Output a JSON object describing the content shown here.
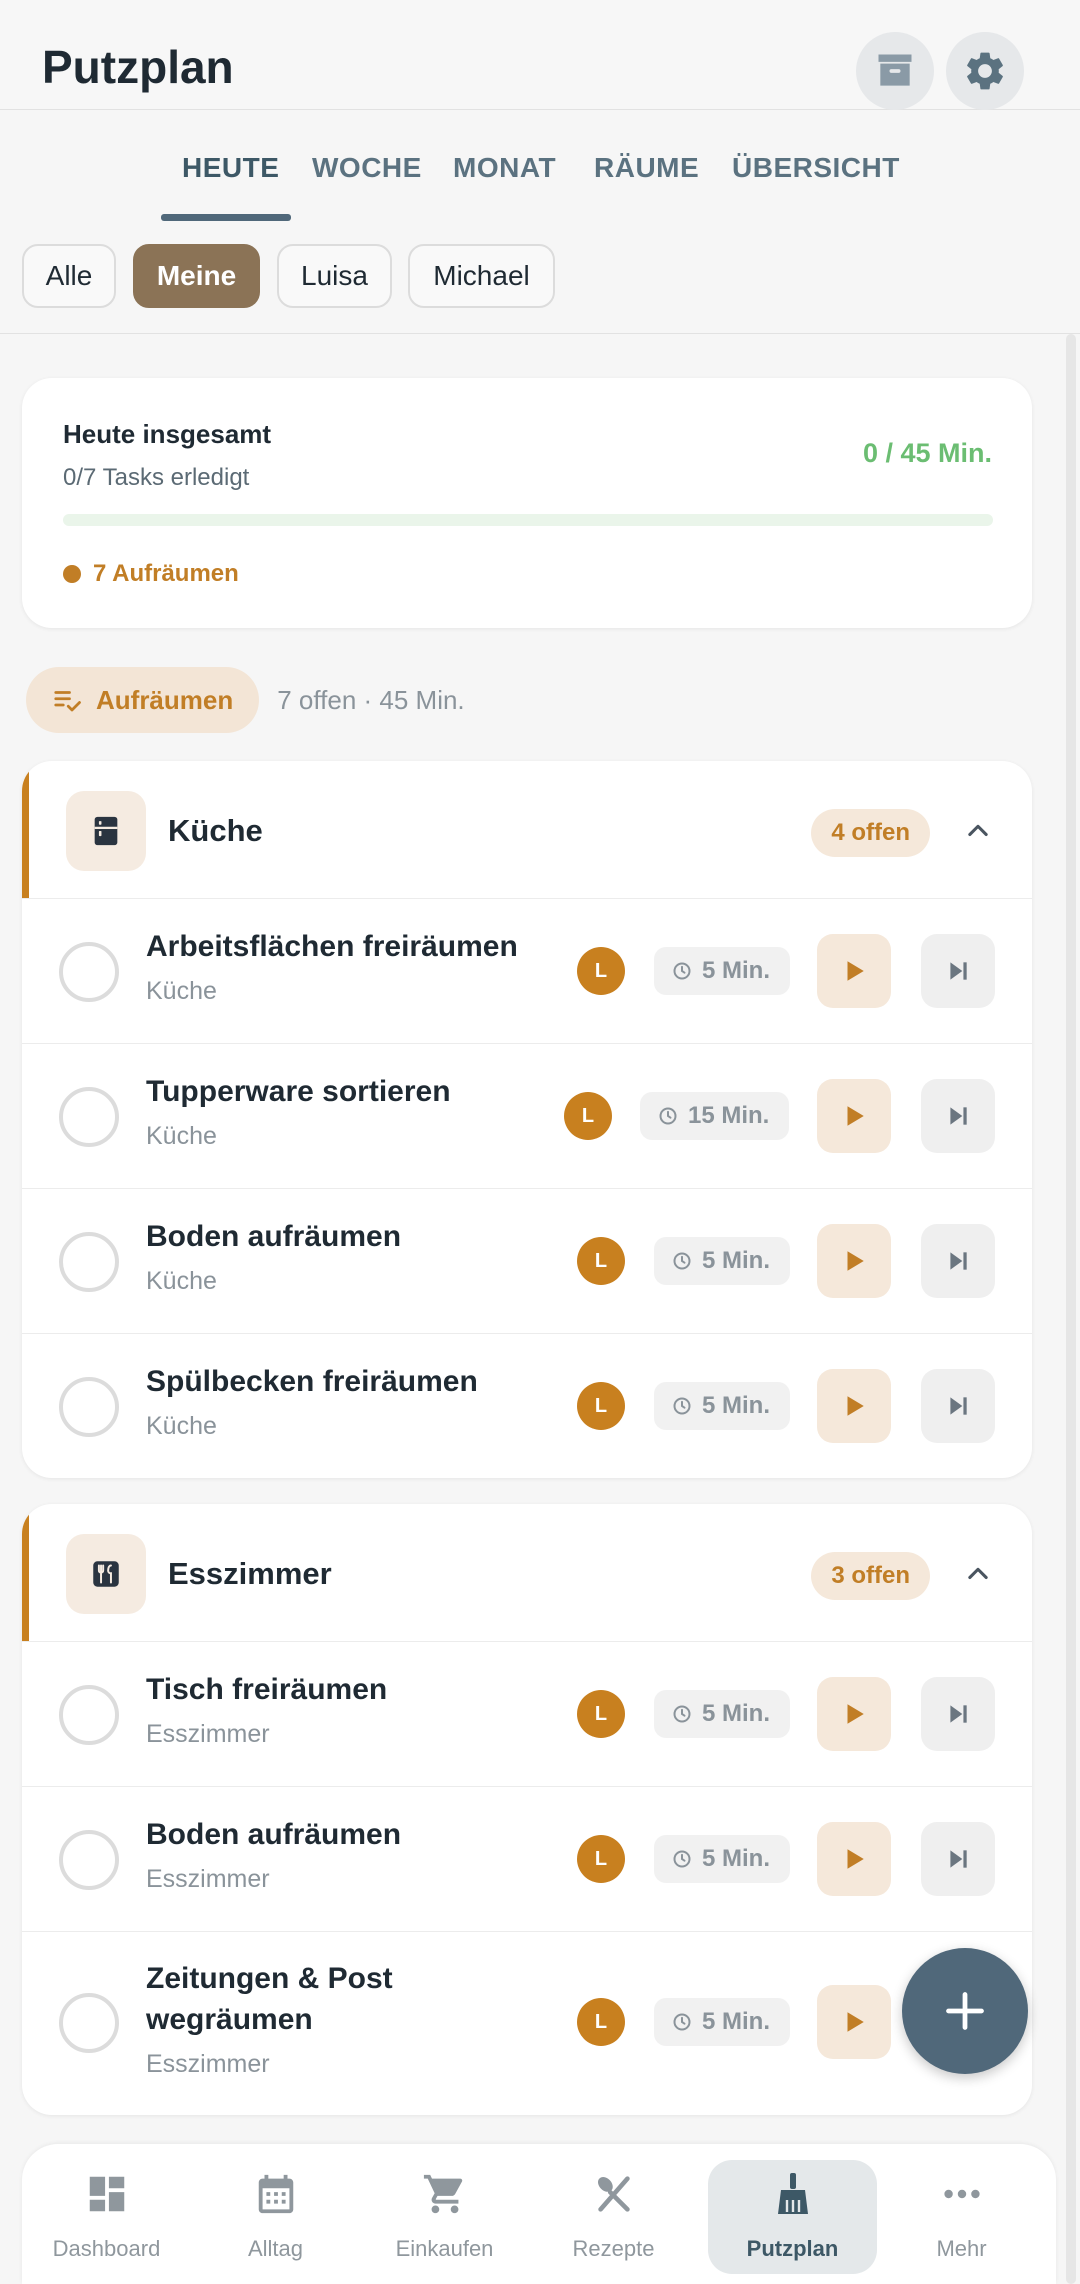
{
  "header": {
    "title": "Putzplan",
    "archive_icon": "archive-icon",
    "settings_icon": "gear-icon"
  },
  "tabs": [
    {
      "label": "HEUTE",
      "active": true
    },
    {
      "label": "WOCHE",
      "active": false
    },
    {
      "label": "MONAT",
      "active": false
    },
    {
      "label": "RÄUME",
      "active": false
    },
    {
      "label": "ÜBERSICHT",
      "active": false
    }
  ],
  "filters": [
    {
      "label": "Alle",
      "active": false
    },
    {
      "label": "Meine",
      "active": true
    },
    {
      "label": "Luisa",
      "active": false
    },
    {
      "label": "Michael",
      "active": false
    }
  ],
  "summary": {
    "title": "Heute insgesamt",
    "subtitle": "0/7 Tasks erledigt",
    "total": "0 / 45 Min.",
    "progress_fraction": 0,
    "category": "7 Aufräumen",
    "category_color": "#c17e26"
  },
  "group": {
    "label": "Aufräumen",
    "meta": "7 offen · 45 Min."
  },
  "rooms": [
    {
      "name": "Küche",
      "icon": "fridge-icon",
      "badge": "4 offen",
      "tasks": [
        {
          "title": "Arbeitsflächen freiräumen",
          "room": "Küche",
          "avatar": "L",
          "time": "5 Min."
        },
        {
          "title": "Tupperware sortieren",
          "room": "Küche",
          "avatar": "L",
          "time": "15 Min."
        },
        {
          "title": "Boden aufräumen",
          "room": "Küche",
          "avatar": "L",
          "time": "5 Min."
        },
        {
          "title": "Spülbecken freiräumen",
          "room": "Küche",
          "avatar": "L",
          "time": "5 Min."
        }
      ]
    },
    {
      "name": "Esszimmer",
      "icon": "cutlery-icon",
      "badge": "3 offen",
      "tasks": [
        {
          "title": "Tisch freiräumen",
          "room": "Esszimmer",
          "avatar": "L",
          "time": "5 Min."
        },
        {
          "title": "Boden aufräumen",
          "room": "Esszimmer",
          "avatar": "L",
          "time": "5 Min."
        },
        {
          "title": "Zeitungen & Post wegräumen",
          "room": "Esszimmer",
          "avatar": "L",
          "time": "5 Min."
        }
      ]
    }
  ],
  "fab_icon": "plus-icon",
  "nav": [
    {
      "label": "Dashboard",
      "icon": "dashboard-icon",
      "active": false
    },
    {
      "label": "Alltag",
      "icon": "calendar-icon",
      "active": false
    },
    {
      "label": "Einkaufen",
      "icon": "cart-icon",
      "active": false
    },
    {
      "label": "Rezepte",
      "icon": "cutlery-icon",
      "active": false
    },
    {
      "label": "Putzplan",
      "icon": "broom-icon",
      "active": true
    },
    {
      "label": "Mehr",
      "icon": "more-icon",
      "active": false
    }
  ],
  "colors": {
    "accent": "#c8801f",
    "primary": "#50687a",
    "chip_active": "#8b7356",
    "success": "#6bbd72"
  }
}
